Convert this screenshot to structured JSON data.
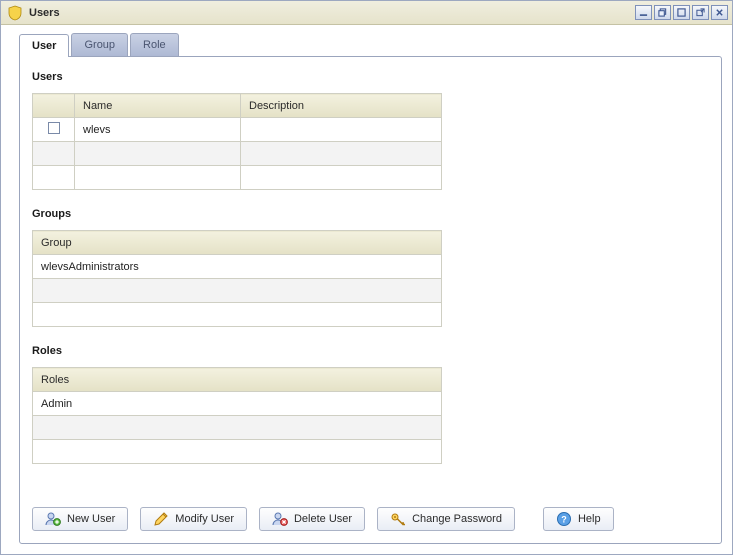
{
  "window": {
    "title": "Users"
  },
  "tabs": [
    {
      "label": "User",
      "active": true
    },
    {
      "label": "Group",
      "active": false
    },
    {
      "label": "Role",
      "active": false
    }
  ],
  "sections": {
    "users": {
      "heading": "Users",
      "columns": {
        "name": "Name",
        "description": "Description"
      },
      "rows": [
        {
          "name": "wlevs",
          "description": ""
        },
        {
          "name": "",
          "description": ""
        },
        {
          "name": "",
          "description": ""
        }
      ]
    },
    "groups": {
      "heading": "Groups",
      "column": "Group",
      "rows": [
        {
          "value": "wlevsAdministrators"
        },
        {
          "value": ""
        },
        {
          "value": ""
        }
      ]
    },
    "roles": {
      "heading": "Roles",
      "column": "Roles",
      "rows": [
        {
          "value": "Admin"
        },
        {
          "value": ""
        },
        {
          "value": ""
        }
      ]
    }
  },
  "buttons": {
    "new_user": "New User",
    "modify_user": "Modify User",
    "delete_user": "Delete User",
    "change_password": "Change Password",
    "help": "Help"
  }
}
